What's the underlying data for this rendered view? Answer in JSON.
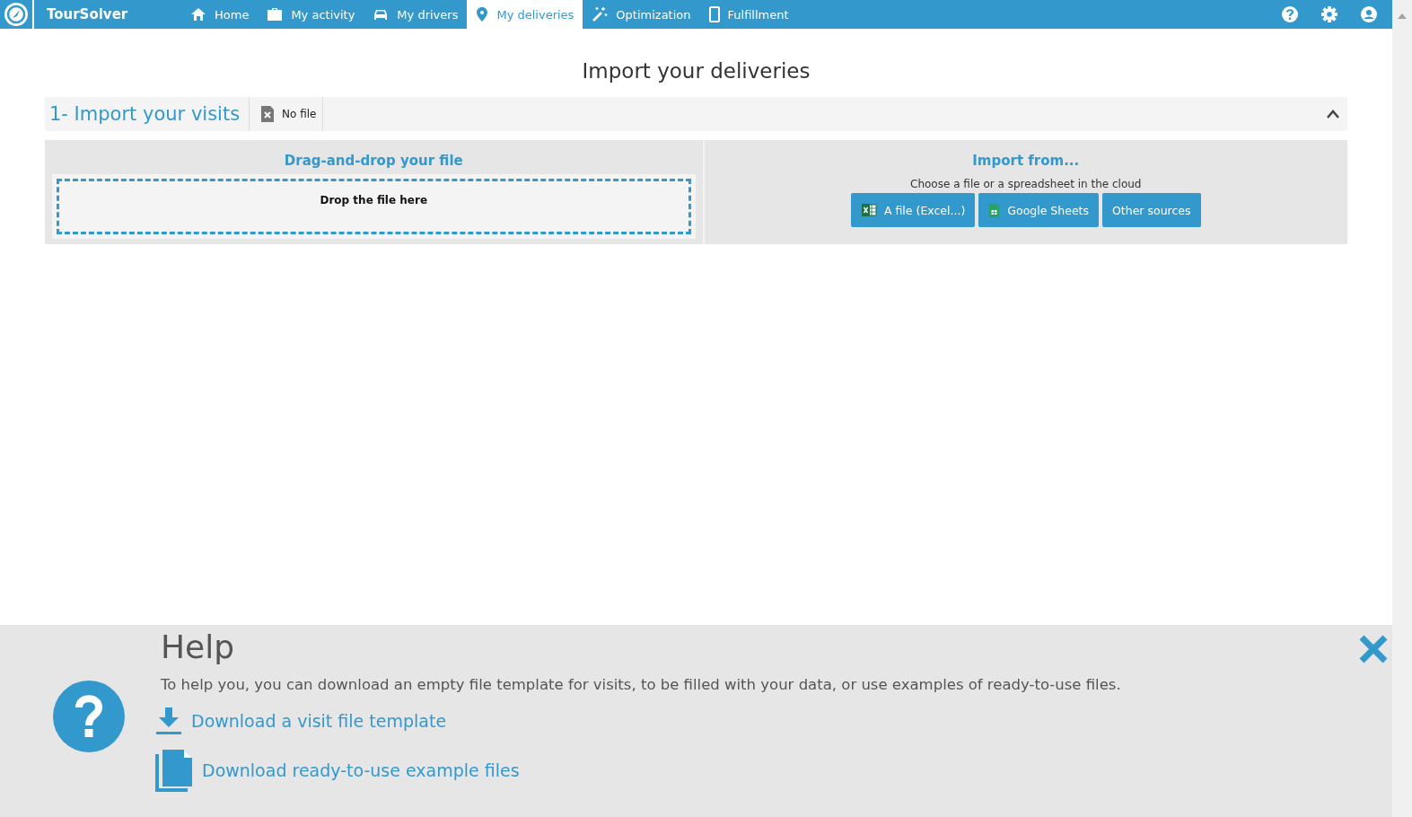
{
  "app": {
    "name": "TourSolver"
  },
  "nav": [
    {
      "label": "Home",
      "kind": "home",
      "selected": false
    },
    {
      "label": "My activity",
      "kind": "activity",
      "selected": false
    },
    {
      "label": "My drivers",
      "kind": "drivers",
      "selected": false
    },
    {
      "label": "My deliveries",
      "kind": "deliveries",
      "selected": true
    },
    {
      "label": "Optimization",
      "kind": "optimization",
      "selected": false
    },
    {
      "label": "Fulfillment",
      "kind": "fulfillment",
      "selected": false
    }
  ],
  "page_title": "Import your deliveries",
  "section": {
    "title": "1- Import your visits",
    "file_status": "No file",
    "expanded": true
  },
  "drop_panel": {
    "title": "Drag-and-drop your file",
    "zone_text": "Drop the file here"
  },
  "import_panel": {
    "title": "Import from...",
    "subtitle": "Choose a file or a spreadsheet in the cloud",
    "buttons": [
      {
        "label": "A file (Excel...)",
        "kind": "file"
      },
      {
        "label": "Google Sheets",
        "kind": "sheets"
      },
      {
        "label": "Other sources",
        "kind": "other"
      }
    ]
  },
  "help": {
    "title": "Help",
    "text": "To help you, you can download an empty file template for visits, to be filled with your data, or use examples of ready-to-use files.",
    "links": [
      {
        "label": "Download a visit file template",
        "kind": "template"
      },
      {
        "label": "Download ready-to-use example files",
        "kind": "examples"
      }
    ]
  }
}
